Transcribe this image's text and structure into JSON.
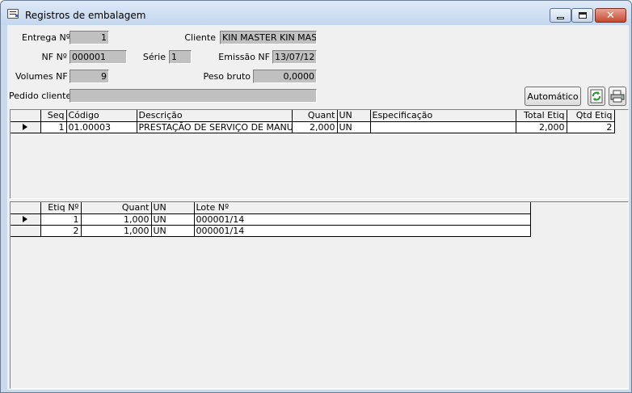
{
  "window": {
    "title": "Registros de embalagem"
  },
  "form": {
    "entrega_label": "Entrega Nº",
    "entrega_value": "1",
    "cliente_label": "Cliente",
    "cliente_value": "KIN MASTER   KIN MAS",
    "nf_label": "NF Nº",
    "nf_value": "000001",
    "serie_label": "Série",
    "serie_value": "1",
    "emissao_label": "Emissão NF",
    "emissao_value": "13/07/12",
    "volumes_label": "Volumes NF",
    "volumes_value": "9",
    "peso_label": "Peso bruto",
    "peso_value": "0,0000",
    "pedido_label": "Pedido cliente",
    "pedido_value": ""
  },
  "toolbar": {
    "auto_label": "Automático",
    "refresh_icon": "refresh-icon",
    "print_icon": "printer-icon"
  },
  "items_grid": {
    "headers": [
      "Seq",
      "Código",
      "Descrição",
      "Quant",
      "UN",
      "Especificação",
      "Total Etiq",
      "Qtd Etiq"
    ],
    "rows": [
      {
        "seq": "1",
        "codigo": "01.00003",
        "descricao": "PRESTAÇÃO DE SERVIÇO DE MANUT",
        "quant": "2,000",
        "un": "UN",
        "especificacao": "",
        "total_etiq": "2,000",
        "qtd_etiq": "2"
      }
    ]
  },
  "labels_grid": {
    "headers": [
      "Etiq Nº",
      "Quant",
      "UN",
      "Lote Nº"
    ],
    "rows": [
      {
        "etiq": "1",
        "quant": "1,000",
        "un": "UN",
        "lote": "000001/14"
      },
      {
        "etiq": "2",
        "quant": "1,000",
        "un": "UN",
        "lote": "000001/14"
      }
    ]
  }
}
